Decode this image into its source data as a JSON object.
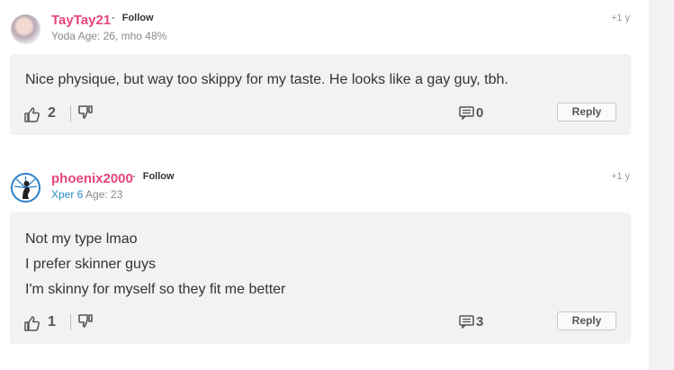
{
  "comments": [
    {
      "username": "TayTay21",
      "separator": "-",
      "follow_label": "Follow",
      "subline": "Yoda Age: 26, mho 48%",
      "time": "+1 y",
      "lines": [
        "Nice physique, but way too skippy for my taste. He looks like a gay guy, tbh."
      ],
      "likes": "2",
      "message_count": "0",
      "reply_label": "Reply"
    },
    {
      "username": "phoenix2000",
      "separator": "-",
      "follow_label": "Follow",
      "subline_xper": "Xper 6",
      "subline_age": "Age: 23",
      "time": "+1 y",
      "lines": [
        "Not my type lmao",
        "I prefer skinner guys",
        "I'm skinny for myself so they fit me better"
      ],
      "likes": "1",
      "message_count": "3",
      "reply_label": "Reply"
    }
  ],
  "colors": {
    "username": "#e6457a",
    "xper": "#2a8cc8",
    "card_bg": "#f2f2f2"
  }
}
